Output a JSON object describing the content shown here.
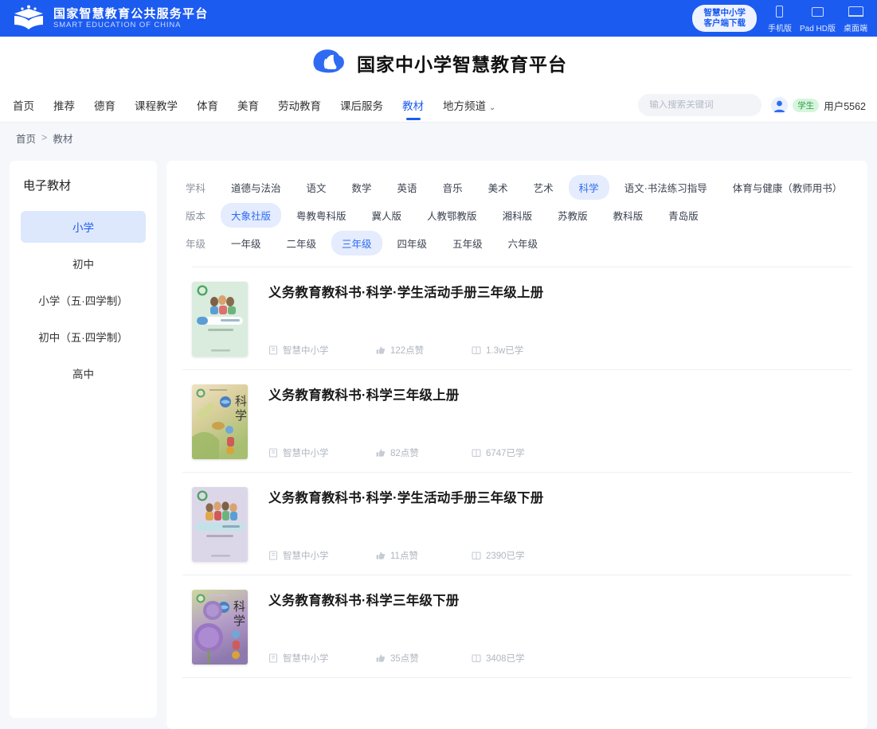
{
  "topbar": {
    "brand_cn": "国家智慧教育公共服务平台",
    "brand_en": "SMART EDUCATION OF CHINA",
    "brand_icon": "open-book-logo-icon",
    "client_btn_line1": "智慧中小学",
    "client_btn_line2": "客户端下载",
    "devices": [
      {
        "icon": "phone-icon",
        "label": "手机版"
      },
      {
        "icon": "tablet-icon",
        "label": "Pad HD版"
      },
      {
        "icon": "desktop-icon",
        "label": "桌面端"
      }
    ]
  },
  "title_area": {
    "logo_icon": "cloud-swan-logo-icon",
    "title": "国家中小学智慧教育平台"
  },
  "nav": {
    "items": [
      {
        "label": "首页",
        "active": false
      },
      {
        "label": "推荐",
        "active": false
      },
      {
        "label": "德育",
        "active": false
      },
      {
        "label": "课程教学",
        "active": false
      },
      {
        "label": "体育",
        "active": false
      },
      {
        "label": "美育",
        "active": false
      },
      {
        "label": "劳动教育",
        "active": false
      },
      {
        "label": "课后服务",
        "active": false
      },
      {
        "label": "教材",
        "active": true
      },
      {
        "label": "地方频道",
        "active": false,
        "caret": true
      }
    ],
    "caret_glyph": "⌄",
    "search": {
      "placeholder": "输入搜索关键词",
      "value": "",
      "icon": "search-icon"
    },
    "user": {
      "avatar_icon": "user-avatar-icon",
      "role": "学生",
      "name": "用户5562"
    }
  },
  "breadcrumb": {
    "home": "首页",
    "separator": ">",
    "current": "教材"
  },
  "sidebar": {
    "title": "电子教材",
    "items": [
      {
        "label": "小学",
        "active": true
      },
      {
        "label": "初中",
        "active": false
      },
      {
        "label": "小学（五·四学制）",
        "active": false
      },
      {
        "label": "初中（五·四学制）",
        "active": false
      },
      {
        "label": "高中",
        "active": false
      }
    ]
  },
  "filters": [
    {
      "label": "学科",
      "options": [
        {
          "label": "道德与法治",
          "active": false
        },
        {
          "label": "语文",
          "active": false
        },
        {
          "label": "数学",
          "active": false
        },
        {
          "label": "英语",
          "active": false
        },
        {
          "label": "音乐",
          "active": false
        },
        {
          "label": "美术",
          "active": false
        },
        {
          "label": "艺术",
          "active": false
        },
        {
          "label": "科学",
          "active": true
        },
        {
          "label": "语文·书法练习指导",
          "active": false
        },
        {
          "label": "体育与健康（教师用书）",
          "active": false
        }
      ]
    },
    {
      "label": "版本",
      "options": [
        {
          "label": "大象社版",
          "active": true
        },
        {
          "label": "粤教粤科版",
          "active": false
        },
        {
          "label": "冀人版",
          "active": false
        },
        {
          "label": "人教鄂教版",
          "active": false
        },
        {
          "label": "湘科版",
          "active": false
        },
        {
          "label": "苏教版",
          "active": false
        },
        {
          "label": "教科版",
          "active": false
        },
        {
          "label": "青岛版",
          "active": false
        }
      ]
    },
    {
      "label": "年级",
      "options": [
        {
          "label": "一年级",
          "active": false
        },
        {
          "label": "二年级",
          "active": false
        },
        {
          "label": "三年级",
          "active": true
        },
        {
          "label": "四年级",
          "active": false
        },
        {
          "label": "五年级",
          "active": false
        },
        {
          "label": "六年级",
          "active": false
        }
      ]
    }
  ],
  "books": [
    {
      "title": "义务教育教科书·科学·学生活动手册三年级上册",
      "publisher": "智慧中小学",
      "likes": "122点赞",
      "learners": "1.3w已学",
      "cover_style": "green-activity-book",
      "cover_color": "#d9ecdd"
    },
    {
      "title": "义务教育教科书·科学三年级上册",
      "publisher": "智慧中小学",
      "likes": "82点赞",
      "learners": "6747已学",
      "cover_style": "nature-photo-book",
      "cover_color": "#e0d5b4"
    },
    {
      "title": "义务教育教科书·科学·学生活动手册三年级下册",
      "publisher": "智慧中小学",
      "likes": "11点赞",
      "learners": "2390已学",
      "cover_style": "lavender-activity-book",
      "cover_color": "#dcd7e8"
    },
    {
      "title": "义务教育教科书·科学三年级下册",
      "publisher": "智慧中小学",
      "likes": "35点赞",
      "learners": "3408已学",
      "cover_style": "purple-flower-book",
      "cover_color": "#b9a3cf"
    }
  ],
  "meta_icons": {
    "publisher": "book-icon",
    "likes": "thumbs-up-icon",
    "learners": "reader-icon"
  },
  "colors": {
    "brand_blue": "#1c5bf0",
    "chip_active_bg": "#e4ecfd",
    "chip_active_text": "#2f6bf2",
    "page_bg": "#f5f7fb",
    "badge_green": "#2ea14b"
  }
}
